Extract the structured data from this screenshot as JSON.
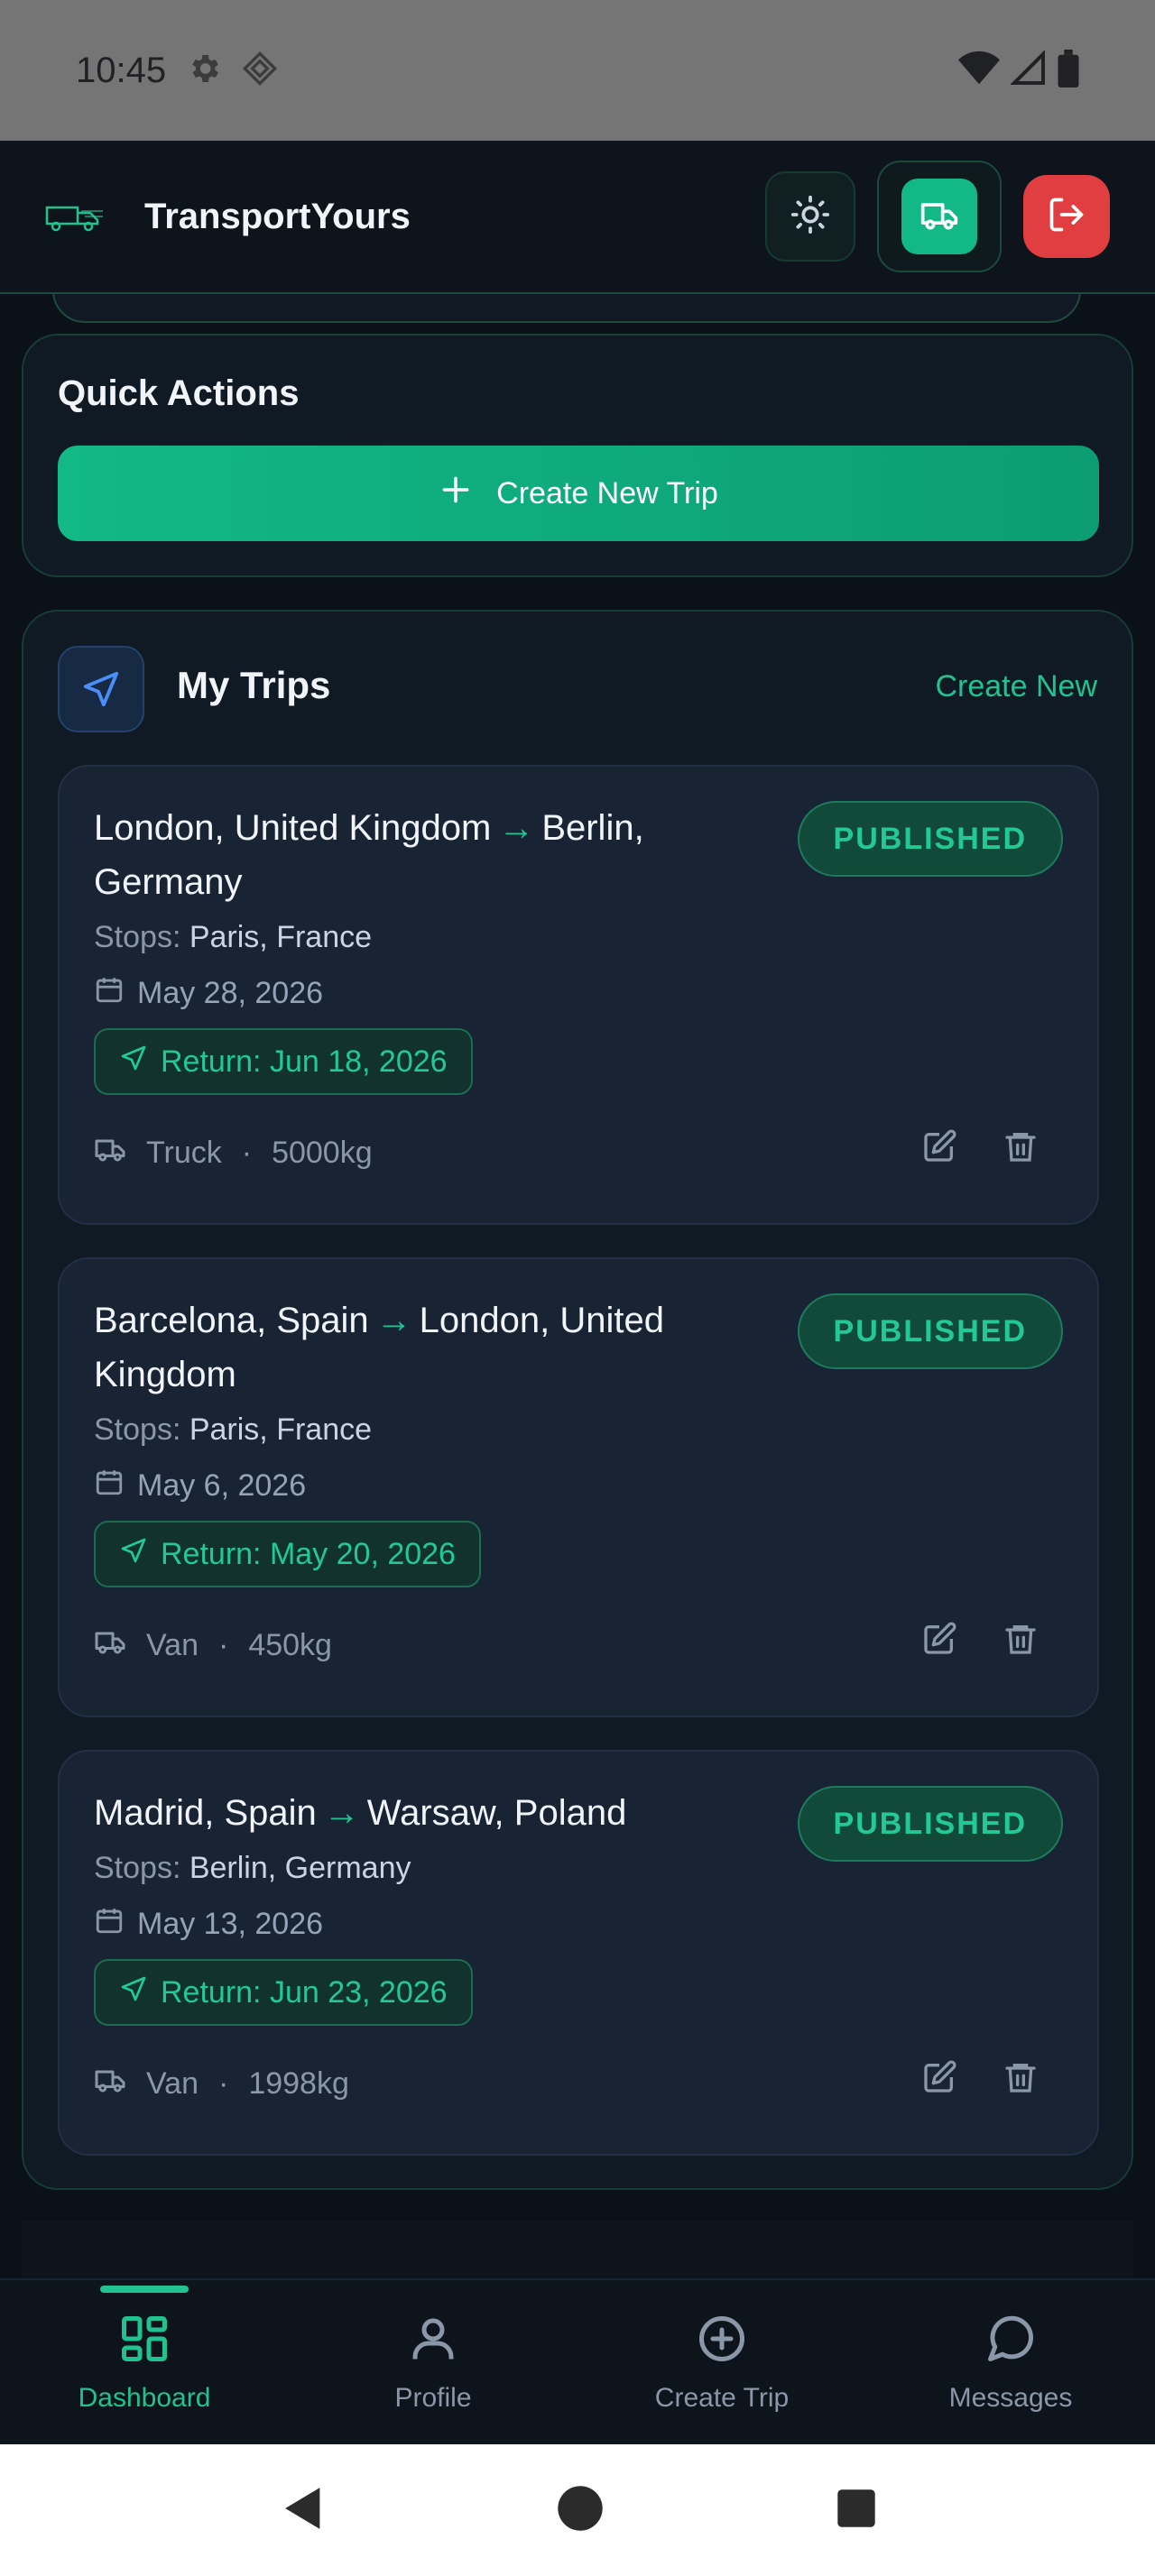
{
  "status_bar": {
    "time": "10:45"
  },
  "header": {
    "brand": "TransportYours"
  },
  "quick_actions": {
    "title": "Quick Actions",
    "create_button": "Create New Trip"
  },
  "trips": {
    "title": "My Trips",
    "create_new": "Create New",
    "stops_label": "Stops:",
    "items": [
      {
        "from": "London, United Kingdom",
        "to": "Berlin, Germany",
        "status": "PUBLISHED",
        "stops": "Paris, France",
        "date": "May 28, 2026",
        "return": "Return: Jun 18, 2026",
        "vehicle": "Truck",
        "separator": "·",
        "capacity": "5000kg"
      },
      {
        "from": "Barcelona, Spain",
        "to": "London, United Kingdom",
        "status": "PUBLISHED",
        "stops": "Paris, France",
        "date": "May 6, 2026",
        "return": "Return: May 20, 2026",
        "vehicle": "Van",
        "separator": "·",
        "capacity": "450kg"
      },
      {
        "from": "Madrid, Spain",
        "to": "Warsaw, Poland",
        "status": "PUBLISHED",
        "stops": "Berlin, Germany",
        "date": "May 13, 2026",
        "return": "Return: Jun 23, 2026",
        "vehicle": "Van",
        "separator": "·",
        "capacity": "1998kg"
      }
    ]
  },
  "bottom_nav": {
    "items": [
      {
        "label": "Dashboard",
        "icon": "dashboard-icon",
        "active": true
      },
      {
        "label": "Profile",
        "icon": "profile-icon",
        "active": false
      },
      {
        "label": "Create Trip",
        "icon": "plus-circle-icon",
        "active": false
      },
      {
        "label": "Messages",
        "icon": "message-icon",
        "active": false
      }
    ]
  },
  "colors": {
    "accent": "#20c38f",
    "background": "#0b1119",
    "card": "#182434",
    "danger": "#e03e41"
  }
}
